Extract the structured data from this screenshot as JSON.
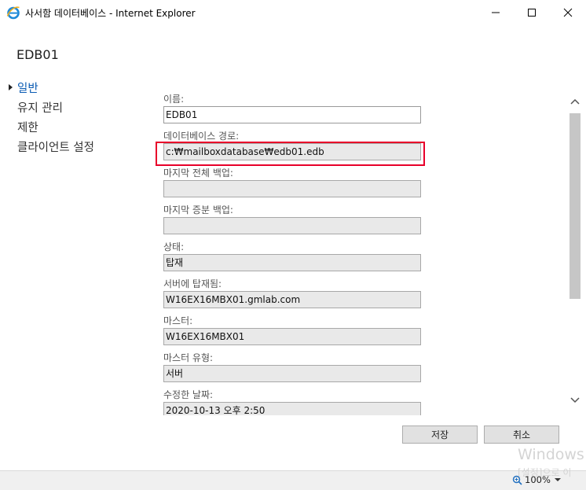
{
  "window": {
    "title": "사서함 데이터베이스 - Internet Explorer",
    "minimize_icon": "minimize-icon",
    "maximize_icon": "maximize-icon",
    "close_icon": "close-icon"
  },
  "header": {
    "database_name": "EDB01"
  },
  "sidebar": {
    "items": [
      {
        "label": "일반",
        "active": true
      },
      {
        "label": "유지 관리",
        "active": false
      },
      {
        "label": "제한",
        "active": false
      },
      {
        "label": "클라이언트 설정",
        "active": false
      }
    ]
  },
  "form": {
    "fields": [
      {
        "label": "이름:",
        "value": "EDB01",
        "editable": true
      },
      {
        "label": "데이터베이스 경로:",
        "value": "c:₩mailboxdatabase₩edb01.edb",
        "editable": false,
        "highlighted": true
      },
      {
        "label": "마지막 전체 백업:",
        "value": "",
        "editable": false
      },
      {
        "label": "마지막 증분 백업:",
        "value": "",
        "editable": false
      },
      {
        "label": "상태:",
        "value": "탑재",
        "editable": false
      },
      {
        "label": "서버에 탑재됨:",
        "value": "W16EX16MBX01.gmlab.com",
        "editable": false
      },
      {
        "label": "마스터:",
        "value": "W16EX16MBX01",
        "editable": false
      },
      {
        "label": "마스터 유형:",
        "value": "서버",
        "editable": false
      },
      {
        "label": "수정한 날짜:",
        "value": "2020-10-13 오후 2:50",
        "editable": false
      }
    ]
  },
  "buttons": {
    "save_label": "저장",
    "cancel_label": "취소"
  },
  "statusbar": {
    "zoom": "100%",
    "zoom_icon": "zoom-icon"
  },
  "watermark": {
    "line1": "Windows",
    "line2": "[설정]으로 이"
  },
  "colors": {
    "accent": "#0a5bb3",
    "highlight": "#e8002a",
    "readonly_bg": "#e9e9e9"
  }
}
